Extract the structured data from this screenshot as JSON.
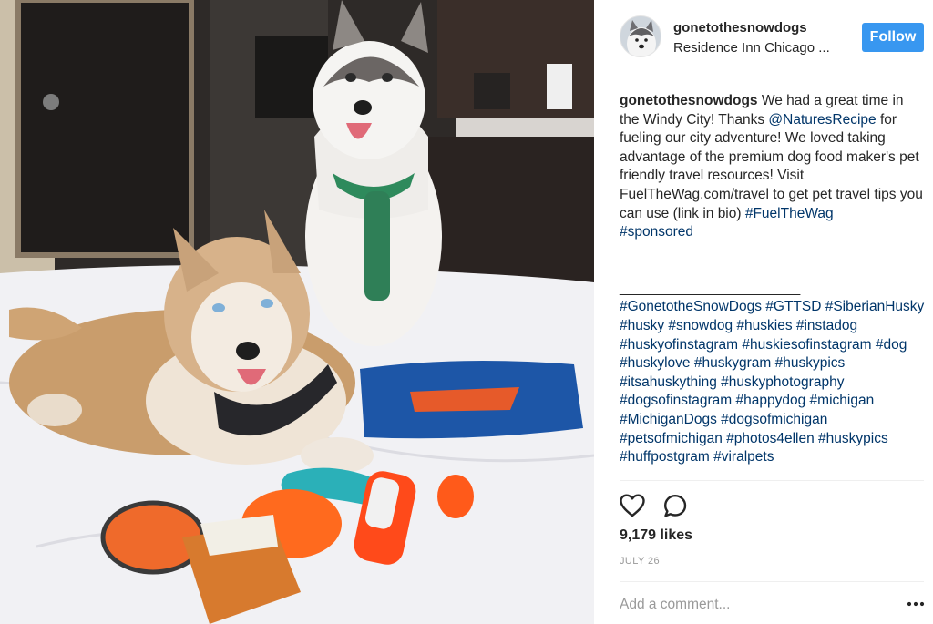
{
  "post": {
    "image_alt_icon": "photo-of-two-huskies",
    "author": {
      "username": "gonetothesnowdogs",
      "location": "Residence Inn Chicago ...",
      "follow_label": "Follow"
    },
    "caption": {
      "author": "gonetothesnowdogs",
      "segments": {
        "text1": " We had a great time in the Windy City! Thanks ",
        "mention": "@NaturesRecipe",
        "text2": " for fueling our city adventure! We loved taking advantage of the premium dog food maker's pet friendly travel resources! Visit FuelTheWag.com/travel to get pet travel tips you can use (link in bio) ",
        "tag1": "#FuelTheWag",
        "tag2": "#sponsored"
      },
      "underscores": "_______________________",
      "hashtags": "#GonetotheSnowDogs #GTTSD #SiberianHusky #husky #snowdog #huskies #instadog #huskyofinstagram #huskiesofinstagram #dog #huskylove #huskygram #huskypics #itsahuskything #huskyphotography #dogsofinstagram #happydog #michigan #MichiganDogs #dogsofmichigan #petsofmichigan #photos4ellen #huskypics #huffpostgram #viralpets"
    },
    "likes": "9,179 likes",
    "date": "JULY 26",
    "comment_placeholder": "Add a comment...",
    "icons": {
      "like": "heart-icon",
      "comment": "comment-bubble-icon",
      "more": "more-options-icon"
    },
    "colors": {
      "follow": "#3897f0",
      "link": "#003569",
      "muted": "#999999"
    }
  }
}
